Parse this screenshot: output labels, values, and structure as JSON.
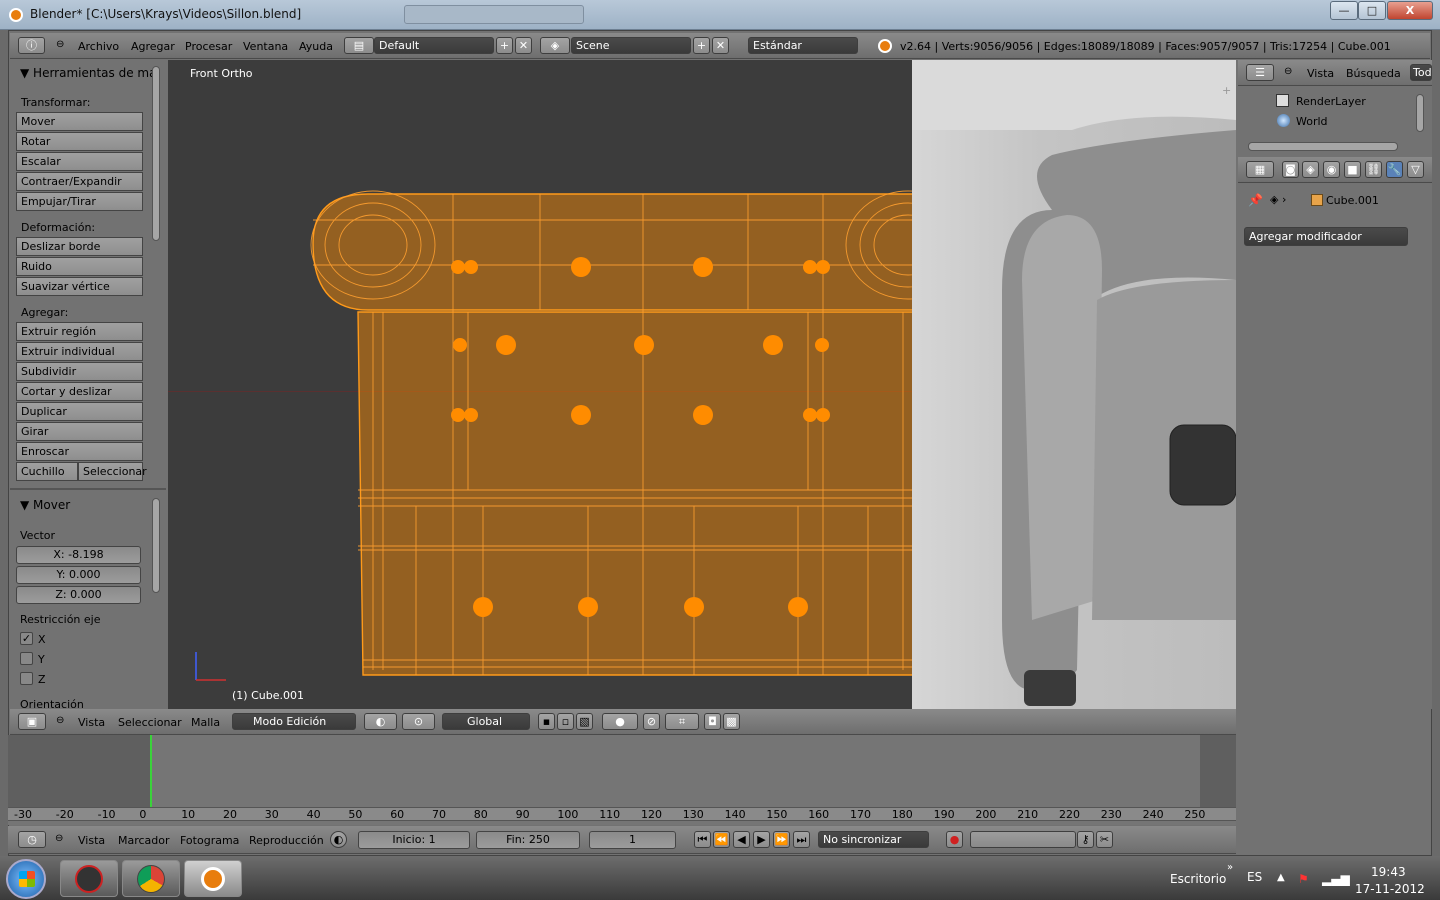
{
  "window": {
    "title": "Blender* [C:\\Users\\Krays\\Videos\\Sillon.blend]",
    "minimize": "—",
    "maximize": "□",
    "close": "X"
  },
  "info_header": {
    "menus": [
      "Archivo",
      "Agregar",
      "Procesar",
      "Ventana",
      "Ayuda"
    ],
    "screen_layout": "Default",
    "scene": "Scene",
    "render_engine": "Estándar",
    "stats": "v2.64 | Verts:9056/9056 | Edges:18089/18089 | Faces:9057/9057 | Tris:17254 | Cube.001"
  },
  "tool_shelf": {
    "title": "Herramientas de mal",
    "transform_label": "Transformar:",
    "transform": [
      "Mover",
      "Rotar",
      "Escalar",
      "Contraer/Expandir",
      "Empujar/Tirar"
    ],
    "deform_label": "Deformación:",
    "deform": [
      "Deslizar borde",
      "Ruido",
      "Suavizar vértice"
    ],
    "add_label": "Agregar:",
    "add": [
      "Extruir región",
      "Extruir individual",
      "Subdividir",
      "Cortar y deslizar bucle",
      "Duplicar",
      "Girar",
      "Enroscar"
    ],
    "knife": "Cuchillo",
    "select": "Seleccionar"
  },
  "operator_panel": {
    "title": "Mover",
    "vector_label": "Vector",
    "x": "X: -8.198",
    "y": "Y: 0.000",
    "z": "Z: 0.000",
    "constraint_label": "Restricción eje",
    "axes": [
      {
        "label": "X",
        "checked": true
      },
      {
        "label": "Y",
        "checked": false
      },
      {
        "label": "Z",
        "checked": false
      }
    ],
    "orientation_label": "Orientación"
  },
  "viewport": {
    "view_name": "Front Ortho",
    "object_label": "(1) Cube.001",
    "selection_color": "#ff8c00"
  },
  "view3d_header": {
    "menus": [
      "Vista",
      "Seleccionar",
      "Malla"
    ],
    "mode": "Modo Edición",
    "orientation": "Global"
  },
  "outliner": {
    "menus": [
      "Vista",
      "Búsqueda",
      "Tod"
    ],
    "items": [
      "RenderLayer",
      "World"
    ]
  },
  "properties": {
    "object_name": "Cube.001",
    "add_modifier": "Agregar modificador"
  },
  "timeline": {
    "ticks": [
      "-30",
      "-20",
      "-10",
      "0",
      "10",
      "20",
      "30",
      "40",
      "50",
      "60",
      "70",
      "80",
      "90",
      "100",
      "110",
      "120",
      "130",
      "140",
      "150",
      "160",
      "170",
      "180",
      "190",
      "200",
      "210",
      "220",
      "230",
      "240",
      "250"
    ],
    "menus": [
      "Vista",
      "Marcador",
      "Fotograma",
      "Reproducción"
    ],
    "start": "Inicio: 1",
    "end": "Fin: 250",
    "current": "1",
    "sync": "No sincronizar"
  },
  "taskbar": {
    "desktop": "Escritorio",
    "language": "ES",
    "time": "19:43",
    "date": "17-11-2012"
  }
}
